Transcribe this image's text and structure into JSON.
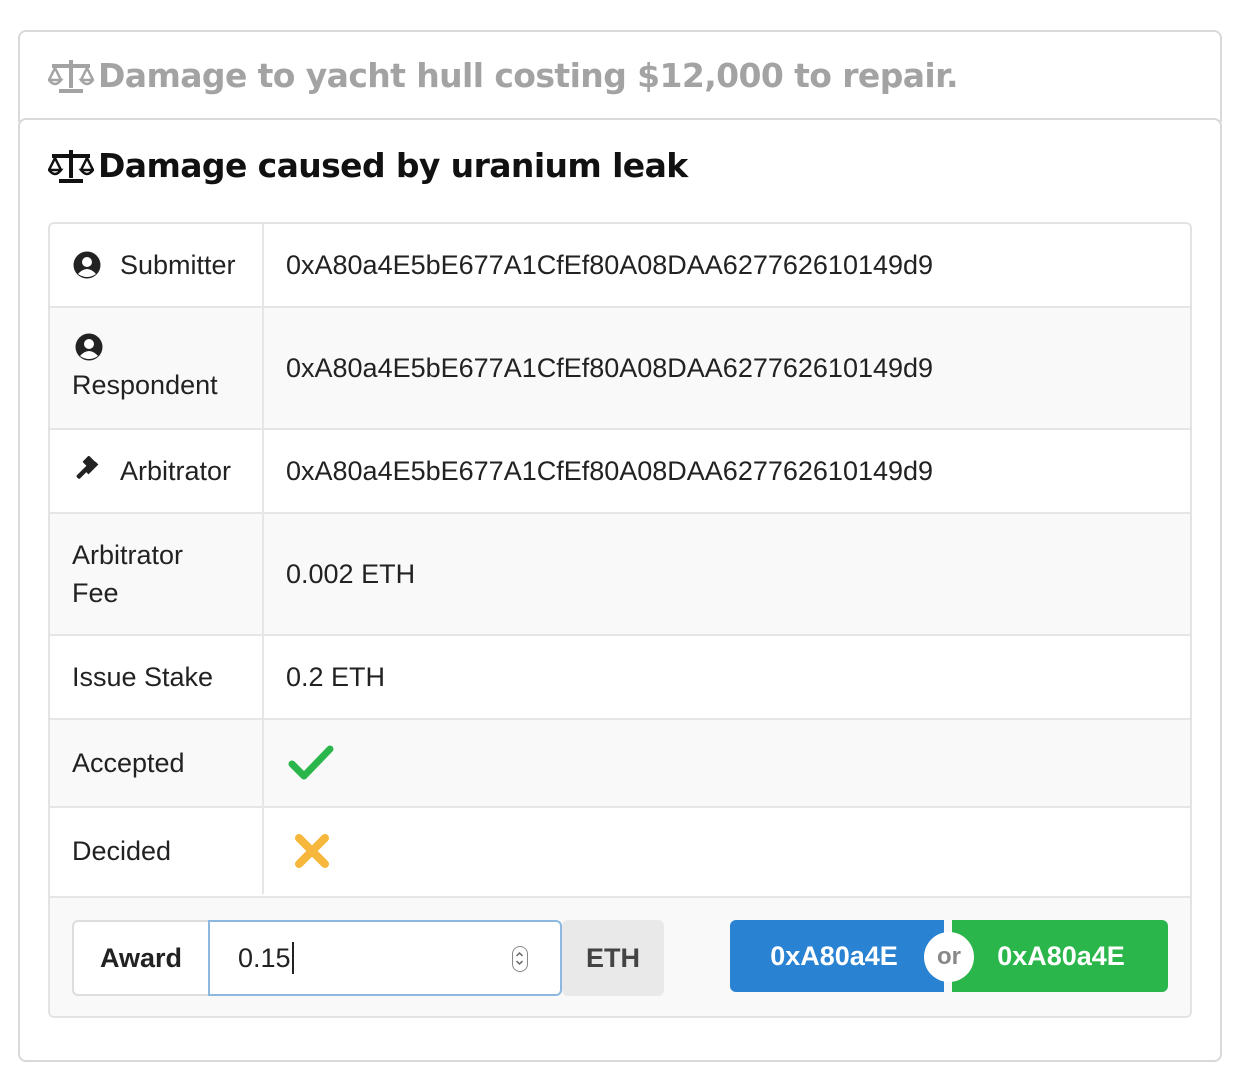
{
  "issues": [
    {
      "title": "Damage to yacht hull costing $12,000 to repair.",
      "icon": "scale-icon"
    },
    {
      "title": "Damage caused by uranium leak",
      "icon": "scale-icon"
    }
  ],
  "details": {
    "submitter": {
      "label": "Submitter",
      "value": "0xA80a4E5bE677A1CfEf80A08DAA627762610149d9",
      "icon": "user-circle-icon"
    },
    "respondent": {
      "label": "Respondent",
      "value": "0xA80a4E5bE677A1CfEf80A08DAA627762610149d9",
      "icon": "user-circle-icon"
    },
    "arbitrator": {
      "label": "Arbitrator",
      "value": "0xA80a4E5bE677A1CfEf80A08DAA627762610149d9",
      "icon": "gavel-icon"
    },
    "arbitrator_fee": {
      "label_line1": "Arbitrator",
      "label_line2": "Fee",
      "value": "0.002 ETH"
    },
    "issue_stake": {
      "label": "Issue Stake",
      "value": "0.2 ETH"
    },
    "accepted": {
      "label": "Accepted",
      "icon": "check-icon",
      "color": "#2ab64a"
    },
    "decided": {
      "label": "Decided",
      "icon": "x-icon",
      "color": "#f6b73c"
    }
  },
  "award": {
    "label": "Award",
    "value": "0.15",
    "unit": "ETH",
    "button_submitter": "0xA80a4E",
    "or_text": "or",
    "button_respondent": "0xA80a4E"
  },
  "colors": {
    "blue_button": "#2a83d2",
    "green_button": "#2ab64a",
    "input_border": "#8fb8e0"
  }
}
